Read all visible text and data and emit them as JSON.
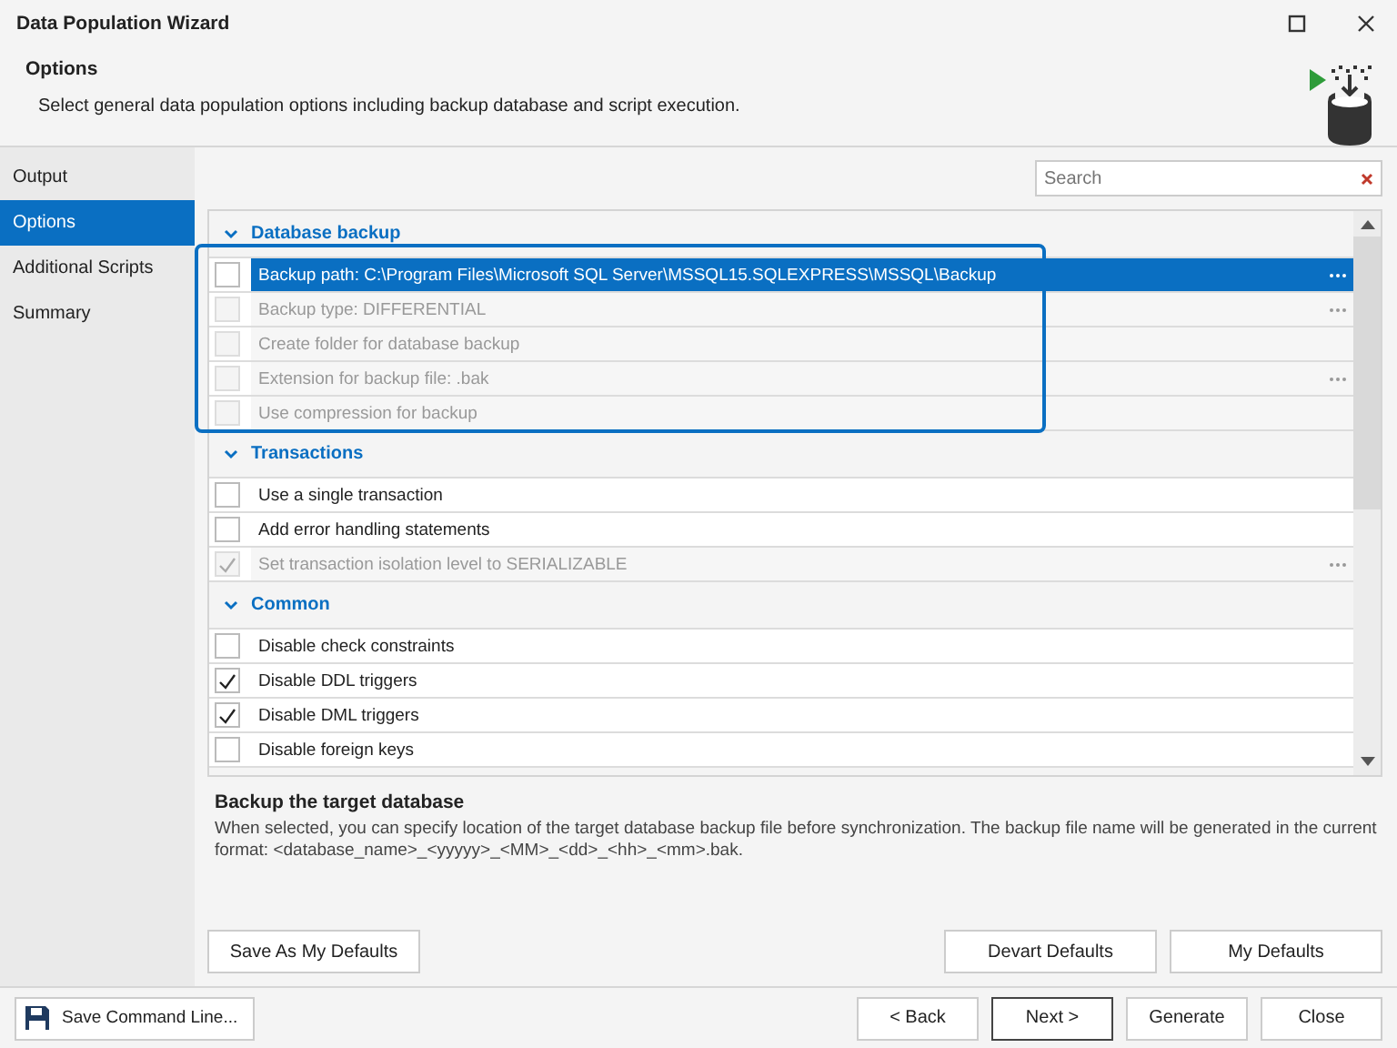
{
  "window": {
    "title": "Data Population Wizard"
  },
  "header": {
    "title": "Options",
    "description": "Select general data population options including backup database and script execution."
  },
  "sidebar": {
    "items": [
      {
        "label": "Output",
        "selected": false
      },
      {
        "label": "Options",
        "selected": true
      },
      {
        "label": "Additional Scripts",
        "selected": false
      },
      {
        "label": "Summary",
        "selected": false
      }
    ]
  },
  "search": {
    "placeholder": "Search"
  },
  "groups": [
    {
      "title": "Database backup",
      "expanded": true,
      "highlighted": true,
      "items": [
        {
          "label": "Backup path: C:\\Program Files\\Microsoft SQL Server\\MSSQL15.SQLEXPRESS\\MSSQL\\Backup",
          "checked": false,
          "disabled": false,
          "selected": true,
          "editor": true
        },
        {
          "label": "Backup type: DIFFERENTIAL",
          "checked": false,
          "disabled": true,
          "selected": false,
          "editor": true
        },
        {
          "label": "Create folder for database backup",
          "checked": false,
          "disabled": true,
          "selected": false,
          "editor": false
        },
        {
          "label": "Extension for backup file: .bak",
          "checked": false,
          "disabled": true,
          "selected": false,
          "editor": true
        },
        {
          "label": "Use compression for backup",
          "checked": false,
          "disabled": true,
          "selected": false,
          "editor": false
        }
      ]
    },
    {
      "title": "Transactions",
      "expanded": true,
      "highlighted": false,
      "items": [
        {
          "label": "Use a single transaction",
          "checked": false,
          "disabled": false,
          "selected": false,
          "editor": false
        },
        {
          "label": "Add error handling statements",
          "checked": false,
          "disabled": false,
          "selected": false,
          "editor": false
        },
        {
          "label": "Set transaction isolation level to SERIALIZABLE",
          "checked": true,
          "disabled": true,
          "selected": false,
          "editor": true
        }
      ]
    },
    {
      "title": "Common",
      "expanded": true,
      "highlighted": false,
      "items": [
        {
          "label": "Disable check constraints",
          "checked": false,
          "disabled": false,
          "selected": false,
          "editor": false
        },
        {
          "label": "Disable DDL triggers",
          "checked": true,
          "disabled": false,
          "selected": false,
          "editor": false
        },
        {
          "label": "Disable DML triggers",
          "checked": true,
          "disabled": false,
          "selected": false,
          "editor": false
        },
        {
          "label": "Disable foreign keys",
          "checked": false,
          "disabled": false,
          "selected": false,
          "editor": false
        }
      ]
    }
  ],
  "details": {
    "title": "Backup the target database",
    "text": "When selected, you can specify location of the target database backup file before synchronization. The backup file name will be generated in the current format: <database_name>_<yyyyy>_<MM>_<dd>_<hh>_<mm>.bak."
  },
  "defaults_buttons": {
    "save": "Save As My Defaults",
    "devart": "Devart Defaults",
    "mine": "My Defaults"
  },
  "footer": {
    "command_line": "Save Command Line...",
    "buttons": [
      {
        "label": "< Back",
        "default": false
      },
      {
        "label": "Next >",
        "default": true
      },
      {
        "label": "Generate",
        "default": false
      },
      {
        "label": "Close",
        "default": false
      }
    ]
  }
}
